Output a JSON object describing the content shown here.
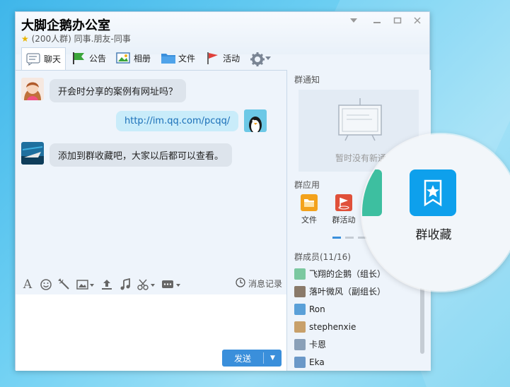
{
  "window": {
    "title": "大脚企鹅办公室",
    "subtitle": "(200人群) 同事.朋友-同事",
    "star": "★"
  },
  "toolbar": {
    "items": [
      {
        "label": "聊天",
        "icon": "chat-bubble-icon"
      },
      {
        "label": "公告",
        "icon": "flag-icon"
      },
      {
        "label": "相册",
        "icon": "photo-album-icon"
      },
      {
        "label": "文件",
        "icon": "folder-icon"
      },
      {
        "label": "活动",
        "icon": "pennant-icon"
      }
    ],
    "settings_icon": "gear-icon"
  },
  "chat": {
    "messages": [
      {
        "side": "left",
        "text": "开会时分享的案例有网址吗？",
        "avatar": "girl-avatar"
      },
      {
        "side": "right",
        "text": "http://im.qq.com/pcqq/",
        "avatar": "penguin-avatar"
      },
      {
        "side": "left",
        "text": "添加到群收藏吧，大家以后都可以查看。",
        "avatar": "boat-avatar"
      }
    ]
  },
  "input": {
    "history_label": "消息记录",
    "send_label": "发送"
  },
  "right_panel": {
    "notice_title": "群通知",
    "notice_empty": "暂时没有新通",
    "apps_title": "群应用",
    "apps": [
      {
        "label": "文件",
        "color": "#f3a21c"
      },
      {
        "label": "群活动",
        "color": "#e0503a"
      }
    ],
    "members_title": "群成员(11/16)",
    "members": [
      "飞翔的企鹅（组长）",
      "落叶微风（副组长）",
      "Ron",
      "stephenxie",
      "卡恩",
      "Eka"
    ]
  },
  "magnifier": {
    "label": "群收藏"
  },
  "colors": {
    "accent": "#3a8fdb",
    "collect": "#0ea0ec",
    "app_green": "#3dbfa0"
  }
}
